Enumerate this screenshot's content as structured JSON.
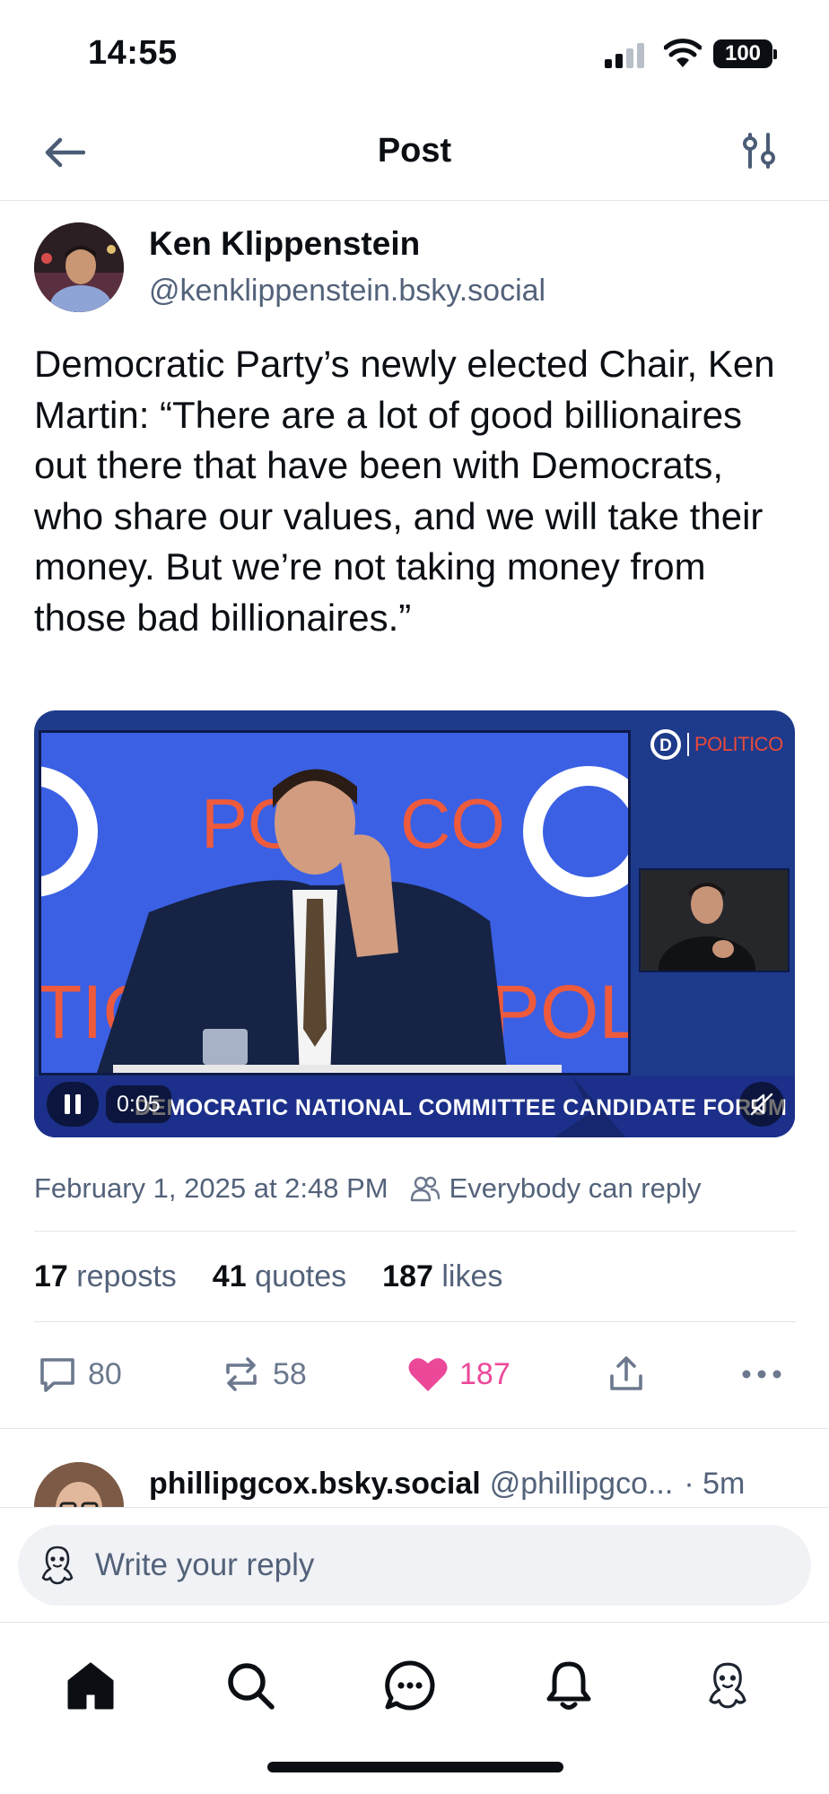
{
  "status_bar": {
    "time": "14:55",
    "battery": "100"
  },
  "header": {
    "title": "Post"
  },
  "post": {
    "author_name": "Ken Klippenstein",
    "author_handle": "@kenklippenstein.bsky.social",
    "text": "Democratic Party’s newly elected Chair, Ken Martin: “There are a lot of good billionaires out there that have been with Democrats, who share our values, and we will take their money. But we’re not taking money from those bad billionaires.”",
    "video": {
      "time": "0:05",
      "banner_text": "DEMOCRATIC NATIONAL COMMITTEE CANDIDATE FORUM",
      "brand": "POLITICO",
      "logo_letter": "D"
    },
    "timestamp": "February 1, 2025 at 2:48 PM",
    "reply_permission": "Everybody can reply",
    "counts": {
      "reposts_value": "17",
      "reposts_label": "reposts",
      "quotes_value": "41",
      "quotes_label": "quotes",
      "likes_value": "187",
      "likes_label": "likes"
    },
    "actions": {
      "replies": "80",
      "reposts": "58",
      "likes": "187"
    }
  },
  "reply_preview": {
    "name": "phillipgcox.bsky.social",
    "handle": "@phillipgco...",
    "time": "· 5m"
  },
  "composer": {
    "placeholder": "Write your reply"
  },
  "colors": {
    "accent": "#1083fe",
    "like": "#ec4899",
    "muted": "#53627a",
    "icon": "#6b788e"
  }
}
